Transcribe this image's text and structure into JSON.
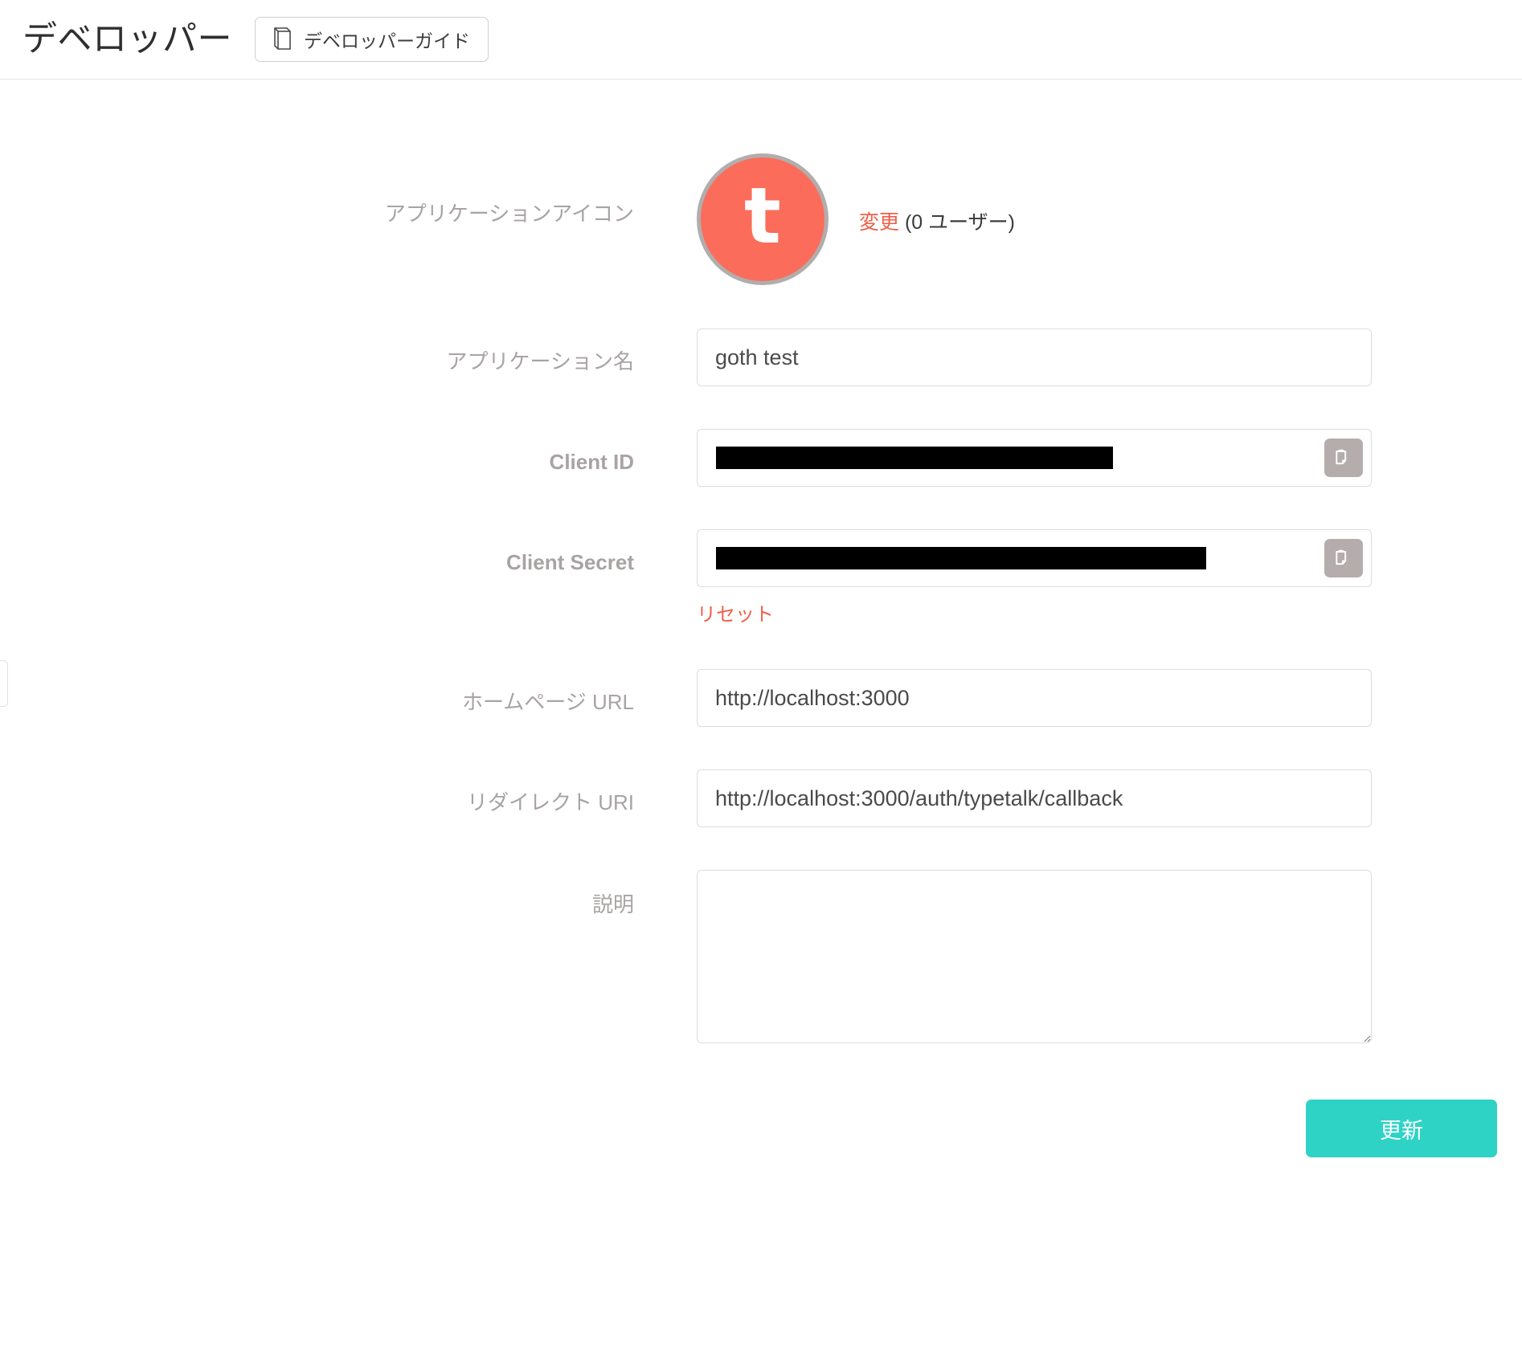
{
  "header": {
    "title": "デベロッパー",
    "guide_button_label": "デベロッパーガイド",
    "guide_button_icon": "book-icon"
  },
  "form": {
    "app_icon": {
      "label": "アプリケーションアイコン",
      "glyph": "t",
      "color": "#fb6c5b",
      "border_color": "#b2adad",
      "change_link": "変更",
      "user_count": "(0 ユーザー)"
    },
    "app_name": {
      "label": "アプリケーション名",
      "value": "goth test",
      "placeholder": ""
    },
    "client_id": {
      "label": "Client ID",
      "value": "",
      "redacted": true,
      "copy_icon": "clipboard-icon"
    },
    "client_secret": {
      "label": "Client Secret",
      "value": "",
      "redacted": true,
      "copy_icon": "clipboard-icon",
      "reset_link": "リセット"
    },
    "homepage_url": {
      "label": "ホームページ URL",
      "value": "http://localhost:3000",
      "placeholder": ""
    },
    "redirect_uri": {
      "label": "リダイレクト URI",
      "value": "http://localhost:3000/auth/typetalk/callback",
      "placeholder": ""
    },
    "description": {
      "label": "説明",
      "value": "",
      "placeholder": ""
    },
    "submit_label": "更新"
  },
  "colors": {
    "accent_link": "#f05f4a",
    "submit": "#2ed3c6",
    "label": "#a9a3a3",
    "icon_background": "#fb6c5b"
  }
}
